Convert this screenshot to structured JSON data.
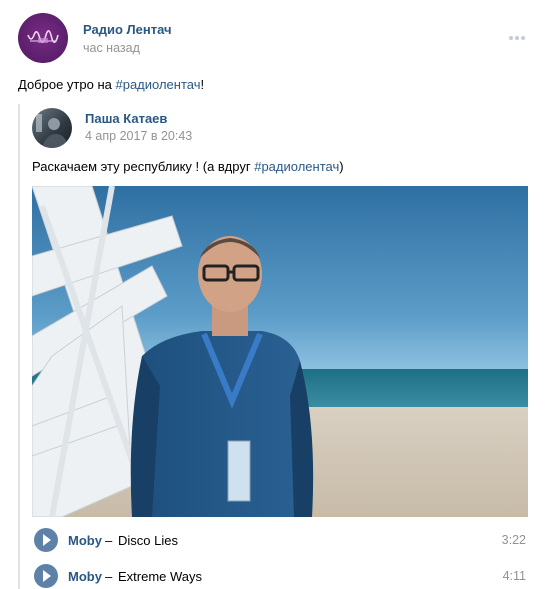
{
  "post": {
    "author": "Радио Лентач",
    "time": "час назад",
    "text_prefix": "Доброе утро на ",
    "hashtag": "#радиолентач",
    "text_suffix": "!"
  },
  "repost": {
    "author": "Паша Катаев",
    "time": "4 апр 2017 в 20:43",
    "text_prefix": "Раскачаем эту республику ! (а вдруг ",
    "hashtag": "#радиолентач",
    "text_suffix": ")"
  },
  "tracks": [
    {
      "artist": "Moby",
      "dash": "–",
      "title": "Disco Lies",
      "duration": "3:22"
    },
    {
      "artist": "Moby",
      "dash": "–",
      "title": "Extreme Ways",
      "duration": "4:11"
    }
  ],
  "colors": {
    "link": "#2a5885",
    "meta": "#939393",
    "play_button": "#5e81a8"
  }
}
